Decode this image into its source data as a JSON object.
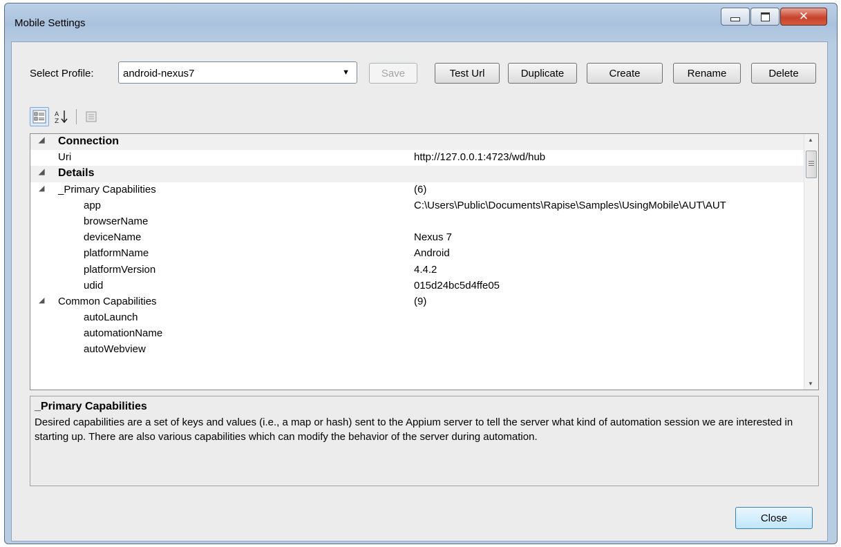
{
  "window": {
    "title": "Mobile Settings"
  },
  "profile": {
    "label": "Select Profile:",
    "selected": "android-nexus7"
  },
  "buttons": {
    "save": "Save",
    "test_url": "Test Url",
    "duplicate": "Duplicate",
    "create": "Create",
    "rename": "Rename",
    "delete": "Delete",
    "close": "Close"
  },
  "grid": {
    "connection": {
      "category": "Connection",
      "uri_name": "Uri",
      "uri_value": "http://127.0.0.1:4723/wd/hub"
    },
    "details": {
      "category": "Details",
      "primary": {
        "name": "_Primary Capabilities",
        "count": "(6)",
        "items": [
          {
            "name": "app",
            "value": "C:\\Users\\Public\\Documents\\Rapise\\Samples\\UsingMobile\\AUT\\AUT"
          },
          {
            "name": "browserName",
            "value": ""
          },
          {
            "name": "deviceName",
            "value": "Nexus 7"
          },
          {
            "name": "platformName",
            "value": "Android"
          },
          {
            "name": "platformVersion",
            "value": "4.4.2"
          },
          {
            "name": "udid",
            "value": "015d24bc5d4ffe05"
          }
        ]
      },
      "common": {
        "name": "Common Capabilities",
        "count": "(9)",
        "items": [
          {
            "name": "autoLaunch",
            "value": ""
          },
          {
            "name": "automationName",
            "value": ""
          },
          {
            "name": "autoWebview",
            "value": ""
          }
        ]
      }
    }
  },
  "help": {
    "title": "_Primary Capabilities",
    "body": "Desired capabilities are a set of keys and values (i.e., a map or hash) sent to the Appium server to tell the server what kind of automation session we are interested in starting up. There are also various capabilities which can modify the behavior of the server during automation."
  },
  "icons": {
    "categorized": "categorized-view-icon",
    "alphabetical": "sort-alphabetical-icon",
    "property_pages": "property-pages-icon",
    "expanded": "expanded-triangle-icon",
    "dropdown": "chevron-down-icon"
  }
}
